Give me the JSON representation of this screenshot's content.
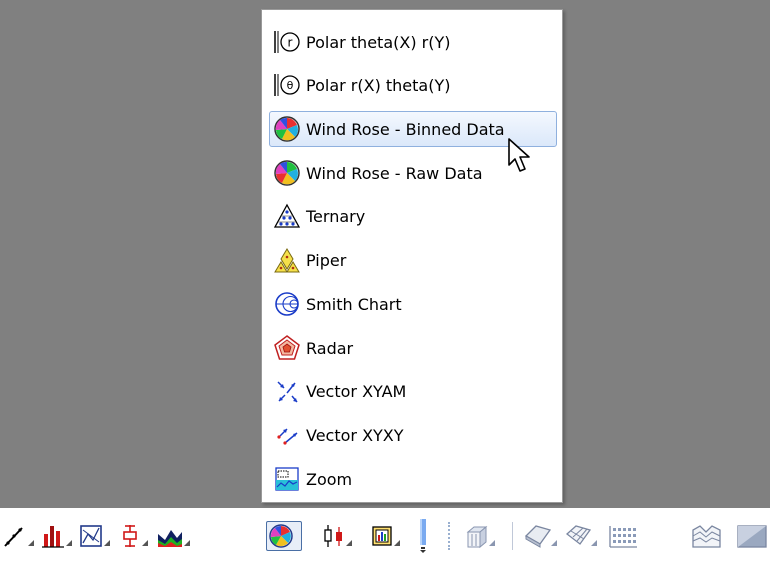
{
  "menu": {
    "items": [
      {
        "label": "Polar theta(X) r(Y)",
        "icon": "polar-r-icon",
        "selected": false
      },
      {
        "label": "Polar r(X) theta(Y)",
        "icon": "polar-theta-icon",
        "selected": false
      },
      {
        "label": "Wind Rose - Binned Data",
        "icon": "wind-rose-binned-icon",
        "selected": true
      },
      {
        "label": "Wind Rose - Raw Data",
        "icon": "wind-rose-raw-icon",
        "selected": false
      },
      {
        "label": "Ternary",
        "icon": "ternary-icon",
        "selected": false
      },
      {
        "label": "Piper",
        "icon": "piper-icon",
        "selected": false
      },
      {
        "label": "Smith Chart",
        "icon": "smith-chart-icon",
        "selected": false
      },
      {
        "label": "Radar",
        "icon": "radar-icon",
        "selected": false
      },
      {
        "label": "Vector XYAM",
        "icon": "vector-xyam-icon",
        "selected": false
      },
      {
        "label": "Vector  XYXY",
        "icon": "vector-xyxy-icon",
        "selected": false
      },
      {
        "label": "Zoom",
        "icon": "zoom-icon",
        "selected": false
      }
    ]
  },
  "toolbar": {
    "buttons": [
      {
        "icon": "line-plot-icon",
        "has_dropdown": true
      },
      {
        "icon": "bar-chart-icon",
        "has_dropdown": true
      },
      {
        "icon": "statistics-plot-icon",
        "has_dropdown": true
      },
      {
        "icon": "error-bar-icon",
        "has_dropdown": true
      },
      {
        "icon": "area-chart-icon",
        "has_dropdown": true
      },
      {
        "icon": "wind-rose-icon",
        "has_dropdown": true,
        "pressed": true
      },
      {
        "icon": "candlestick-icon",
        "has_dropdown": true
      },
      {
        "icon": "multi-panel-icon",
        "has_dropdown": true
      },
      {
        "icon": "more-tools-icon",
        "has_dropdown": true
      },
      {
        "icon": "3d-bars-icon",
        "has_dropdown": true
      },
      {
        "icon": "3d-surface-icon",
        "has_dropdown": true
      },
      {
        "icon": "3d-wireframe-icon",
        "has_dropdown": true
      },
      {
        "icon": "3d-scatter-icon",
        "has_dropdown": false
      },
      {
        "icon": "3d-waterfall-icon",
        "has_dropdown": false
      },
      {
        "icon": "3d-color-map-icon",
        "has_dropdown": false
      }
    ]
  }
}
